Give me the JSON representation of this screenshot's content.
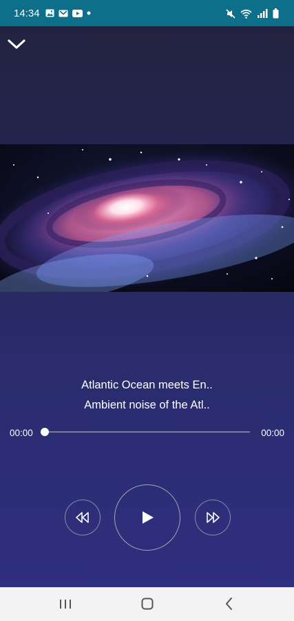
{
  "status_bar": {
    "time": "14:34",
    "left_icons": [
      "gallery-icon",
      "mail-icon",
      "youtube-icon",
      "notification-dot-icon"
    ],
    "right_icons": [
      "mute-icon",
      "wifi-icon",
      "signal-icon",
      "battery-icon"
    ],
    "background": "#0d6f8a"
  },
  "player": {
    "track_title": "Atlantic Ocean meets En..",
    "track_subtitle": "Ambient noise of the Atl..",
    "elapsed": "00:00",
    "total": "00:00",
    "progress": 0,
    "artwork": "galaxy-artwork"
  },
  "controls": [
    "rewind-icon",
    "play-icon",
    "fast-forward-icon"
  ],
  "nav_bar": [
    "recent-apps-icon",
    "home-icon",
    "back-icon"
  ]
}
